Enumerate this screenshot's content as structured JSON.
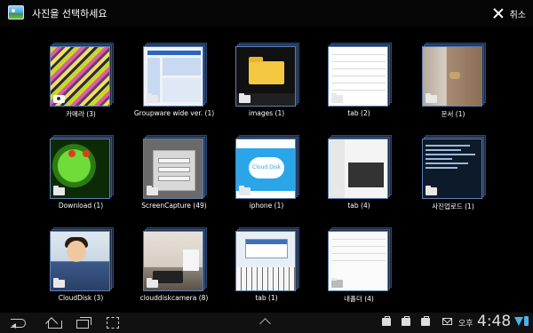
{
  "header": {
    "title": "사진을 선택하세요",
    "cancel_label": "취소"
  },
  "albums": [
    {
      "label": "카메라 (3)"
    },
    {
      "label": "Groupware wide ver. (1)"
    },
    {
      "label": "images (1)"
    },
    {
      "label": "tab (2)"
    },
    {
      "label": "문서 (1)"
    },
    {
      "label": "Download (1)"
    },
    {
      "label": "ScreenCapture (49)"
    },
    {
      "label": "iphone (1)"
    },
    {
      "label": "tab (4)"
    },
    {
      "label": "사진업로드 (1)"
    },
    {
      "label": "CloudDisk (3)"
    },
    {
      "label": "clouddiskcamera (8)"
    },
    {
      "label": "tab (1)"
    },
    {
      "label": "내폴더 (4)"
    }
  ],
  "thumb_text": {
    "iphone_cloud": "Cloud Disk"
  },
  "statusbar": {
    "ampm": "오후",
    "time": "4:48"
  },
  "colors": {
    "background": "#000000",
    "accent": "#4ab3e8",
    "thumb_border": "#5d7fb0"
  }
}
